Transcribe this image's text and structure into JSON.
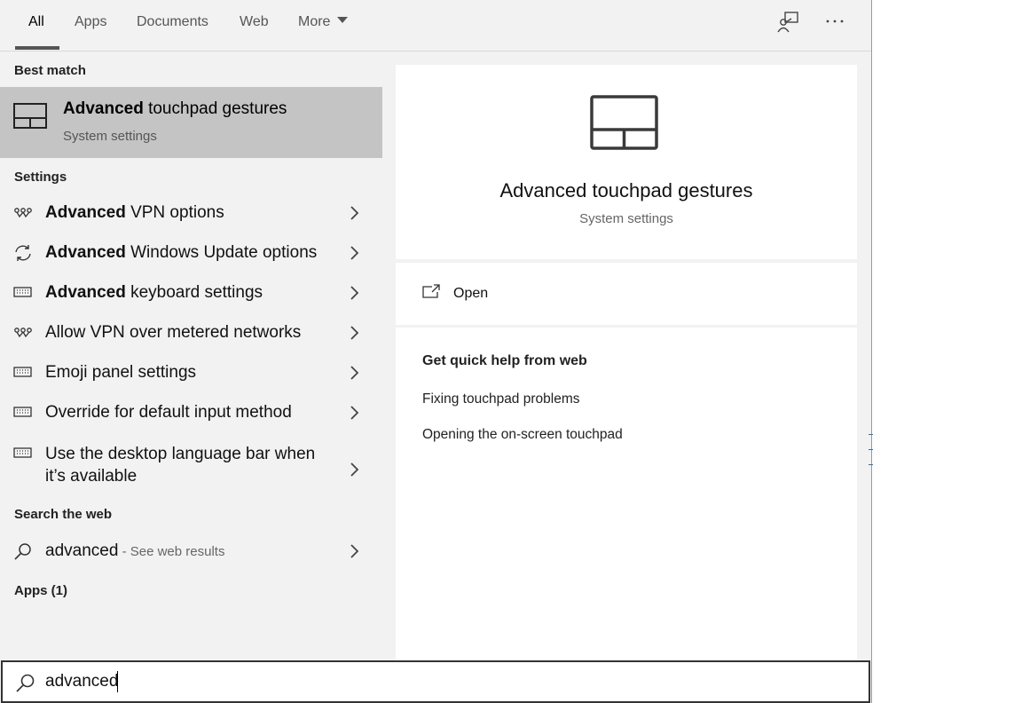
{
  "tabs": [
    {
      "label": "All",
      "active": true
    },
    {
      "label": "Apps"
    },
    {
      "label": "Documents"
    },
    {
      "label": "Web"
    },
    {
      "label": "More"
    }
  ],
  "top_icons": [
    "feedback-icon",
    "more-options-icon"
  ],
  "sections": {
    "best_match": "Best match",
    "settings": "Settings",
    "search_web": "Search the web",
    "apps": "Apps (1)"
  },
  "best_match": {
    "title_bold": "Advanced",
    "title_rest": " touchpad gestures",
    "subtitle": "System settings",
    "icon": "touchpad-icon"
  },
  "settings_items": [
    {
      "bold": "Advanced",
      "rest": " VPN options",
      "icon": "vpn-icon"
    },
    {
      "bold": "Advanced",
      "rest": " Windows Update options",
      "icon": "sync-icon"
    },
    {
      "bold": "Advanced",
      "rest": " keyboard settings",
      "icon": "keyboard-icon"
    },
    {
      "bold": "",
      "rest": "Allow VPN over metered networks",
      "icon": "vpn-icon"
    },
    {
      "bold": "",
      "rest": "Emoji panel settings",
      "icon": "keyboard-icon"
    },
    {
      "bold": "",
      "rest": "Override for default input method",
      "icon": "keyboard-icon"
    },
    {
      "bold": "",
      "rest": "Use the desktop language bar when it’s available",
      "icon": "keyboard-icon"
    }
  ],
  "web_result": {
    "term": "advanced",
    "suffix": " - See web results",
    "icon": "search-icon"
  },
  "preview": {
    "title": "Advanced touchpad gestures",
    "subtitle": "System settings",
    "open_label": "Open",
    "help_title": "Get quick help from web",
    "help_links": [
      "Fixing touchpad problems",
      "Opening the on-screen touchpad"
    ]
  },
  "search": {
    "value": "advanced",
    "placeholder": ""
  }
}
